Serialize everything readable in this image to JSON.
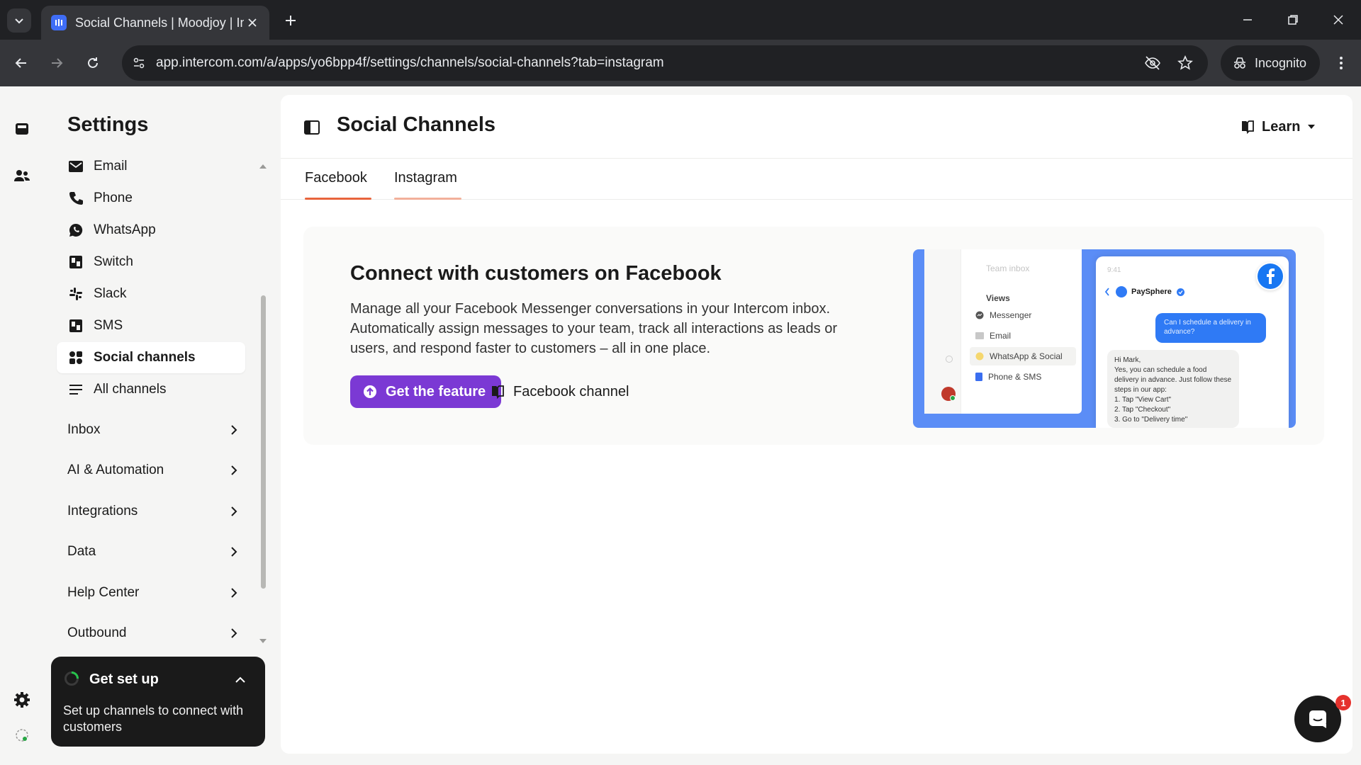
{
  "browser": {
    "tab_title": "Social Channels | Moodjoy | Int",
    "url": "app.intercom.com/a/apps/yo6bpp4f/settings/channels/social-channels?tab=instagram",
    "incognito_label": "Incognito"
  },
  "sidebar": {
    "title": "Settings",
    "channel_items": [
      {
        "label": "Email",
        "icon": "email-icon"
      },
      {
        "label": "Phone",
        "icon": "phone-icon"
      },
      {
        "label": "WhatsApp",
        "icon": "whatsapp-icon"
      },
      {
        "label": "Switch",
        "icon": "switch-icon"
      },
      {
        "label": "Slack",
        "icon": "slack-icon"
      },
      {
        "label": "SMS",
        "icon": "sms-icon"
      },
      {
        "label": "Social channels",
        "icon": "social-channels-icon",
        "active": true
      },
      {
        "label": "All channels",
        "icon": "all-channels-icon"
      }
    ],
    "sections": [
      {
        "label": "Inbox"
      },
      {
        "label": "AI & Automation"
      },
      {
        "label": "Integrations"
      },
      {
        "label": "Data"
      },
      {
        "label": "Help Center"
      },
      {
        "label": "Outbound"
      }
    ]
  },
  "setup_card": {
    "title": "Get set up",
    "subtitle": "Set up channels to connect with customers"
  },
  "main": {
    "title": "Social Channels",
    "learn_label": "Learn",
    "tabs": [
      {
        "label": "Facebook",
        "active": true
      },
      {
        "label": "Instagram",
        "hovered": true
      }
    ],
    "promo": {
      "title": "Connect with customers on Facebook",
      "description": "Manage all your Facebook Messenger conversations in your Intercom inbox. Automatically assign messages to your team, track all interactions as leads or users, and respond faster to customers – all in one place.",
      "primary_cta": "Get the feature",
      "secondary_cta": "Facebook channel"
    },
    "illustration": {
      "inbox_label": "Team inbox",
      "views_label": "Views",
      "view_items": [
        "Messenger",
        "Email",
        "WhatsApp & Social",
        "Phone & SMS"
      ],
      "time": "9:41",
      "contact_name": "PaySphere",
      "outgoing_message": "Can I schedule a delivery in advance?",
      "incoming_message": "Hi Mark,\nYes, you can schedule a food delivery in advance. Just follow these steps in our app:\n1. Tap \"View Cart\"\n2. Tap \"Checkout\"\n3. Go to \"Delivery time\""
    }
  },
  "messenger": {
    "badge_count": "1"
  },
  "colors": {
    "accent_primary": "#7b39d4",
    "tab_underline": "#e8643c",
    "facebook_blue": "#1877f2"
  }
}
